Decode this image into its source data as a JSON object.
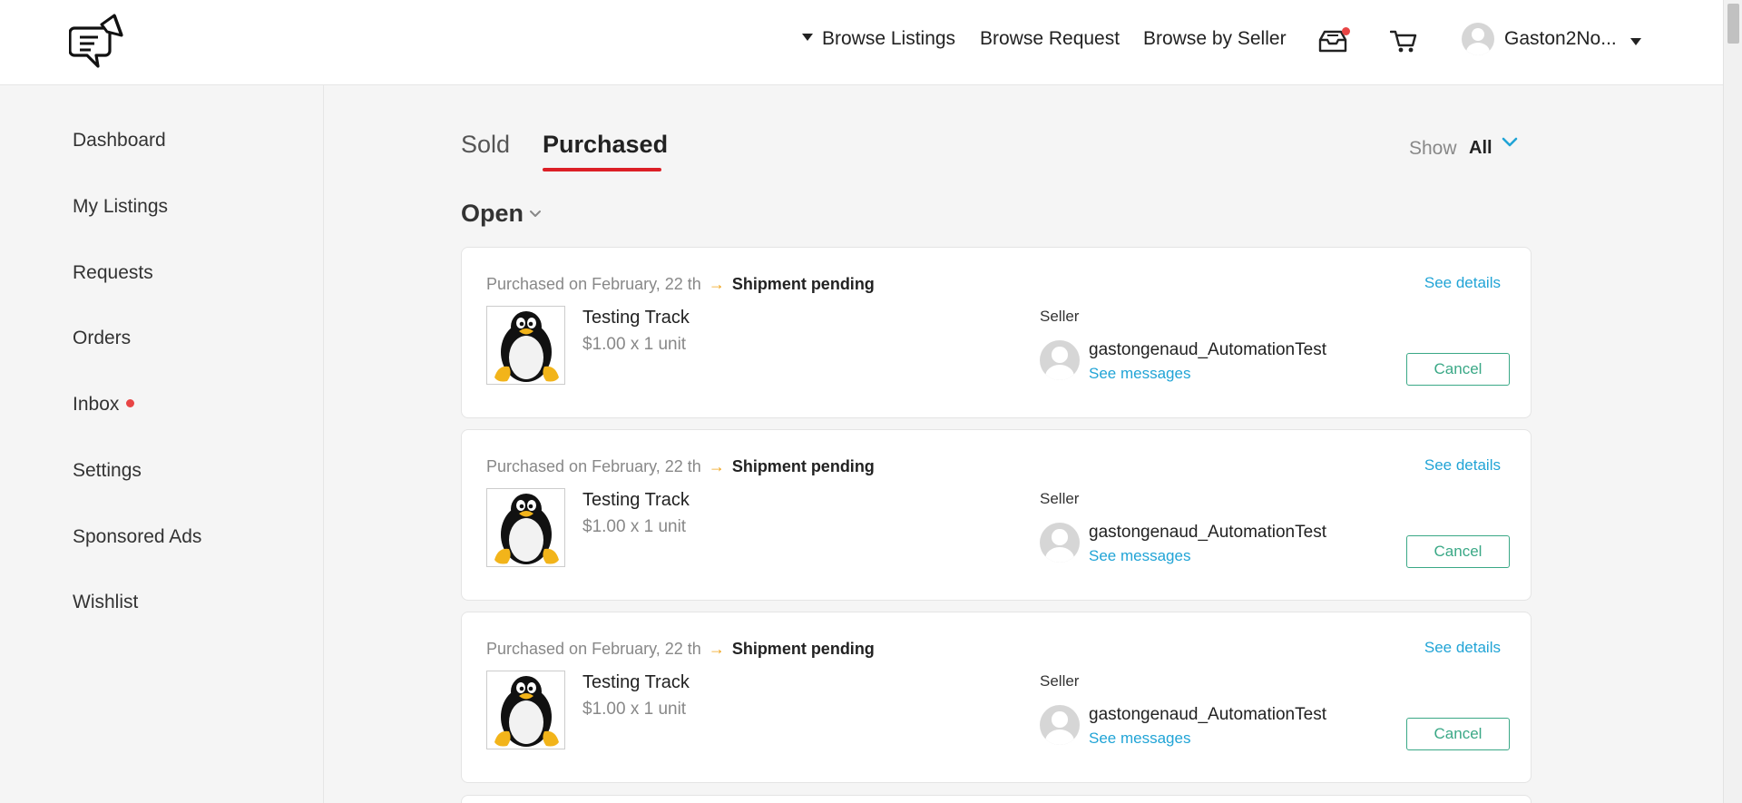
{
  "header": {
    "nav": {
      "browse_listings": "Browse Listings",
      "browse_request": "Browse Request",
      "browse_by_seller": "Browse by Seller"
    },
    "icons": {
      "logo": "megaphone-chat-logo-icon",
      "inbox": "inbox-tray-icon",
      "cart": "shopping-cart-icon",
      "user_menu": "caret-down-icon"
    },
    "username": "Gaston2No..."
  },
  "sidebar": {
    "items": [
      {
        "label": "Dashboard"
      },
      {
        "label": "My Listings"
      },
      {
        "label": "Requests"
      },
      {
        "label": "Orders"
      },
      {
        "label": "Inbox"
      },
      {
        "label": "Settings"
      },
      {
        "label": "Sponsored Ads"
      },
      {
        "label": "Wishlist"
      }
    ]
  },
  "tabs": {
    "sold": "Sold",
    "purchased": "Purchased",
    "active": "Purchased"
  },
  "filter": {
    "show_label": "Show",
    "show_value": "All"
  },
  "section": {
    "title": "Open"
  },
  "orders": [
    {
      "date_text": "Purchased on February, 22 th",
      "status": "Shipment pending",
      "see_details": "See details",
      "item_title": "Testing Track",
      "item_price": "$1.00 x 1 unit",
      "seller_label": "Seller",
      "seller_name": "gastongenaud_AutomationTest",
      "see_messages": "See messages",
      "cancel": "Cancel"
    },
    {
      "date_text": "Purchased on February, 22 th",
      "status": "Shipment pending",
      "see_details": "See details",
      "item_title": "Testing Track",
      "item_price": "$1.00 x 1 unit",
      "seller_label": "Seller",
      "seller_name": "gastongenaud_AutomationTest",
      "see_messages": "See messages",
      "cancel": "Cancel"
    },
    {
      "date_text": "Purchased on February, 22 th",
      "status": "Shipment pending",
      "see_details": "See details",
      "item_title": "Testing Track",
      "item_price": "$1.00 x 1 unit",
      "seller_label": "Seller",
      "seller_name": "gastongenaud_AutomationTest",
      "see_messages": "See messages",
      "cancel": "Cancel"
    }
  ],
  "colors": {
    "accent_red": "#dc1f26",
    "link_blue": "#21a4d6",
    "cancel_green": "#3aa886",
    "arrow_orange": "#f0a51c",
    "notification_red": "#e84545"
  }
}
